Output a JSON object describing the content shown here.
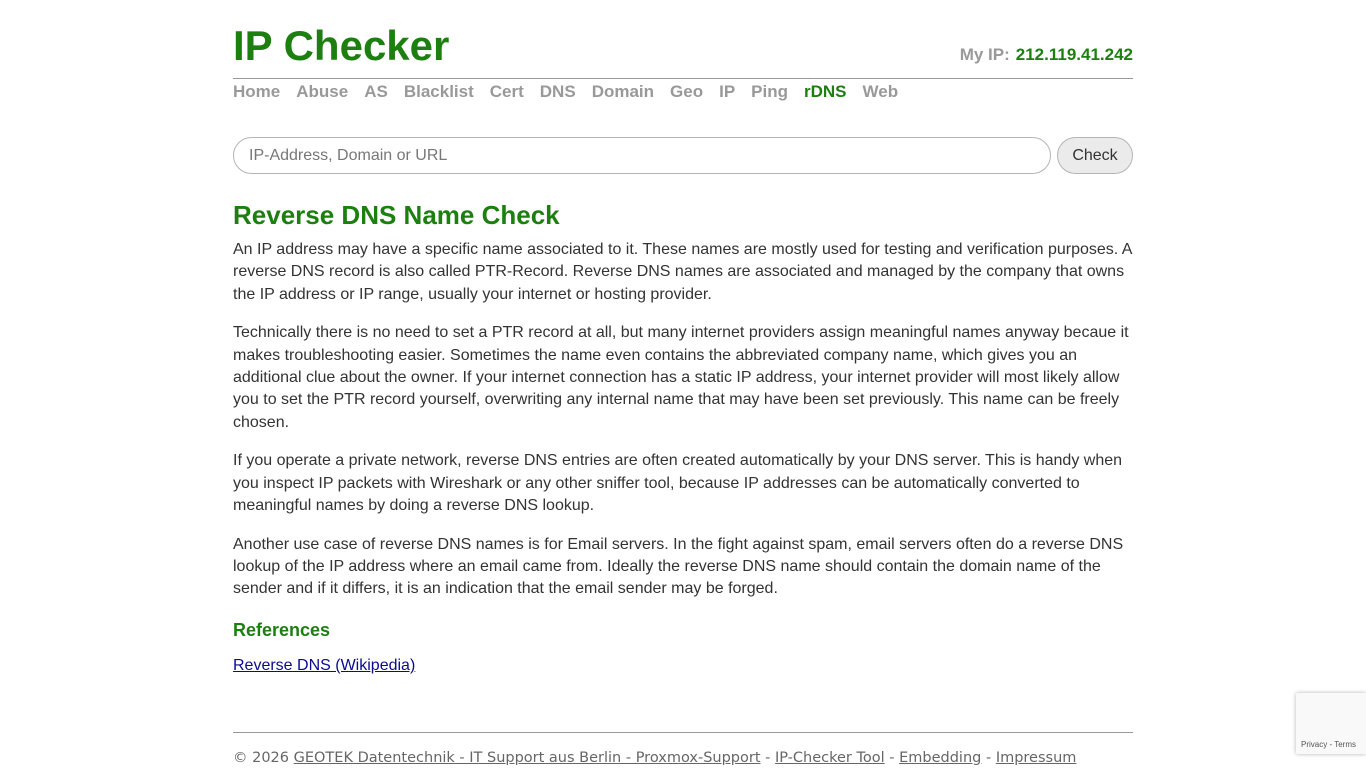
{
  "header": {
    "logo": "IP Checker",
    "my_ip_label": "My IP:",
    "my_ip_value": "212.119.41.242"
  },
  "nav": {
    "items": [
      "Home",
      "Abuse",
      "AS",
      "Blacklist",
      "Cert",
      "DNS",
      "Domain",
      "Geo",
      "IP",
      "Ping",
      "rDNS",
      "Web"
    ],
    "active": "rDNS"
  },
  "search": {
    "placeholder": "IP-Address, Domain or URL",
    "value": "",
    "button_label": "Check"
  },
  "main": {
    "title": "Reverse DNS Name Check",
    "paragraphs": [
      "An IP address may have a specific name associated to it. These names are mostly used for testing and verification purposes. A reverse DNS record is also called PTR-Record. Reverse DNS names are associated and managed by the company that owns the IP address or IP range, usually your internet or hosting provider.",
      "Technically there is no need to set a PTR record at all, but many internet providers assign meaningful names anyway becaue it makes troubleshooting easier. Sometimes the name even contains the abbreviated company name, which gives you an additional clue about the owner. If your internet connection has a static IP address, your internet provider will most likely allow you to set the PTR record yourself, overwriting any internal name that may have been set previously. This name can be freely chosen.",
      "If you operate a private network, reverse DNS entries are often created automatically by your DNS server. This is handy when you inspect IP packets with Wireshark or any other sniffer tool, because IP addresses can be automatically converted to meaningful names by doing a reverse DNS lookup.",
      "Another use case of reverse DNS names is for Email servers. In the fight against spam, email servers often do a reverse DNS lookup of the IP address where an email came from. Ideally the reverse DNS name should contain the domain name of the sender and if it differs, it is an indication that the email sender may be forged."
    ],
    "references_heading": "References",
    "reference_link": "Reverse DNS (Wikipedia)"
  },
  "footer": {
    "copyright": "© 2026",
    "link_company": "GEOTEK Datentechnik - IT Support aus Berlin - Proxmox-Support",
    "separator": "-",
    "link_tool": "IP-Checker Tool",
    "link_embedding": "Embedding",
    "link_impressum": "Impressum"
  },
  "recaptcha": {
    "privacy": "Privacy",
    "separator": "-",
    "terms": "Terms"
  },
  "colors": {
    "brand_green": "#1c7f10",
    "nav_gray": "#999999",
    "link_blue": "#0b0b8f"
  }
}
